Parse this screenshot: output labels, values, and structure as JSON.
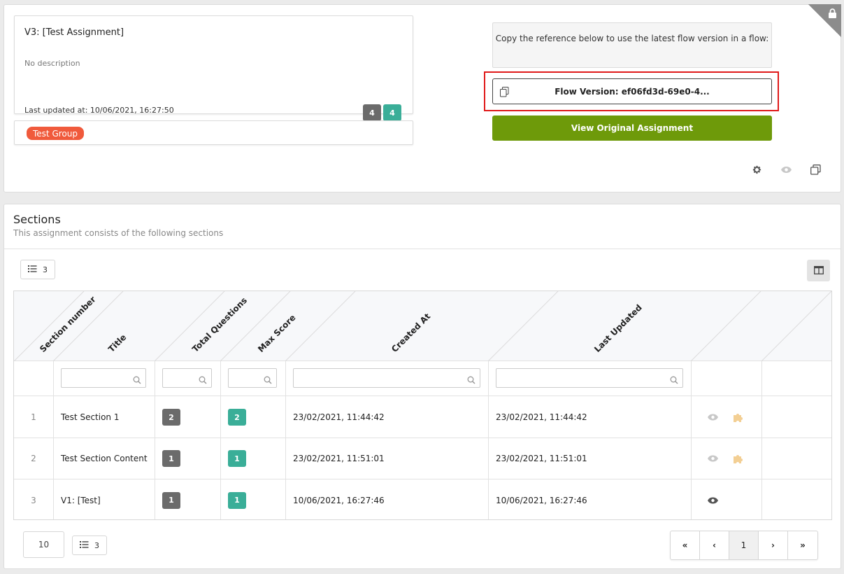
{
  "assignment": {
    "title": "V3: [Test Assignment]",
    "description": "No description",
    "last_updated": "Last updated at: 10/06/2021, 16:27:50",
    "badge_grey": "4",
    "badge_teal": "4",
    "group_tag": "Test Group"
  },
  "flow": {
    "copy_note": "Copy the reference below to use the latest flow version in a flow:",
    "flow_version": "Flow Version: ef06fd3d-69e0-4...",
    "view_original": "View Original Assignment"
  },
  "icons": {
    "lock": "lock-icon",
    "copy": "copy-icon",
    "settings": "gear-icon",
    "preview": "eye-icon",
    "duplicate": "duplicate-icon",
    "list": "list-icon",
    "columns": "columns-icon",
    "search": "search-icon",
    "puzzle": "puzzle-icon"
  },
  "colors": {
    "accent_green": "#6e9a0a",
    "group_tag": "#f05a3c",
    "badge_grey": "#6b6b6b",
    "badge_teal": "#3aae98",
    "highlight": "#e01a1a"
  },
  "sections": {
    "title": "Sections",
    "subtitle": "This assignment consists of the following sections",
    "row_count": "3",
    "columns": [
      "Section number",
      "Title",
      "Total Questions",
      "Max Score",
      "Created At",
      "Last Updated"
    ],
    "rows": [
      {
        "number": "1",
        "title": "Test Section 1",
        "total_questions": "2",
        "max_score": "2",
        "created_at": "23/02/2021, 11:44:42",
        "last_updated": "23/02/2021, 11:44:42"
      },
      {
        "number": "2",
        "title": "Test Section Content",
        "total_questions": "1",
        "max_score": "1",
        "created_at": "23/02/2021, 11:51:01",
        "last_updated": "23/02/2021, 11:51:01"
      },
      {
        "number": "3",
        "title": "V1: [Test]",
        "total_questions": "1",
        "max_score": "1",
        "created_at": "10/06/2021, 16:27:46",
        "last_updated": "10/06/2021, 16:27:46"
      }
    ]
  },
  "pagination": {
    "page_size": "10",
    "row_count": "3",
    "first": "«",
    "prev": "‹",
    "current": "1",
    "next": "›",
    "last": "»"
  }
}
